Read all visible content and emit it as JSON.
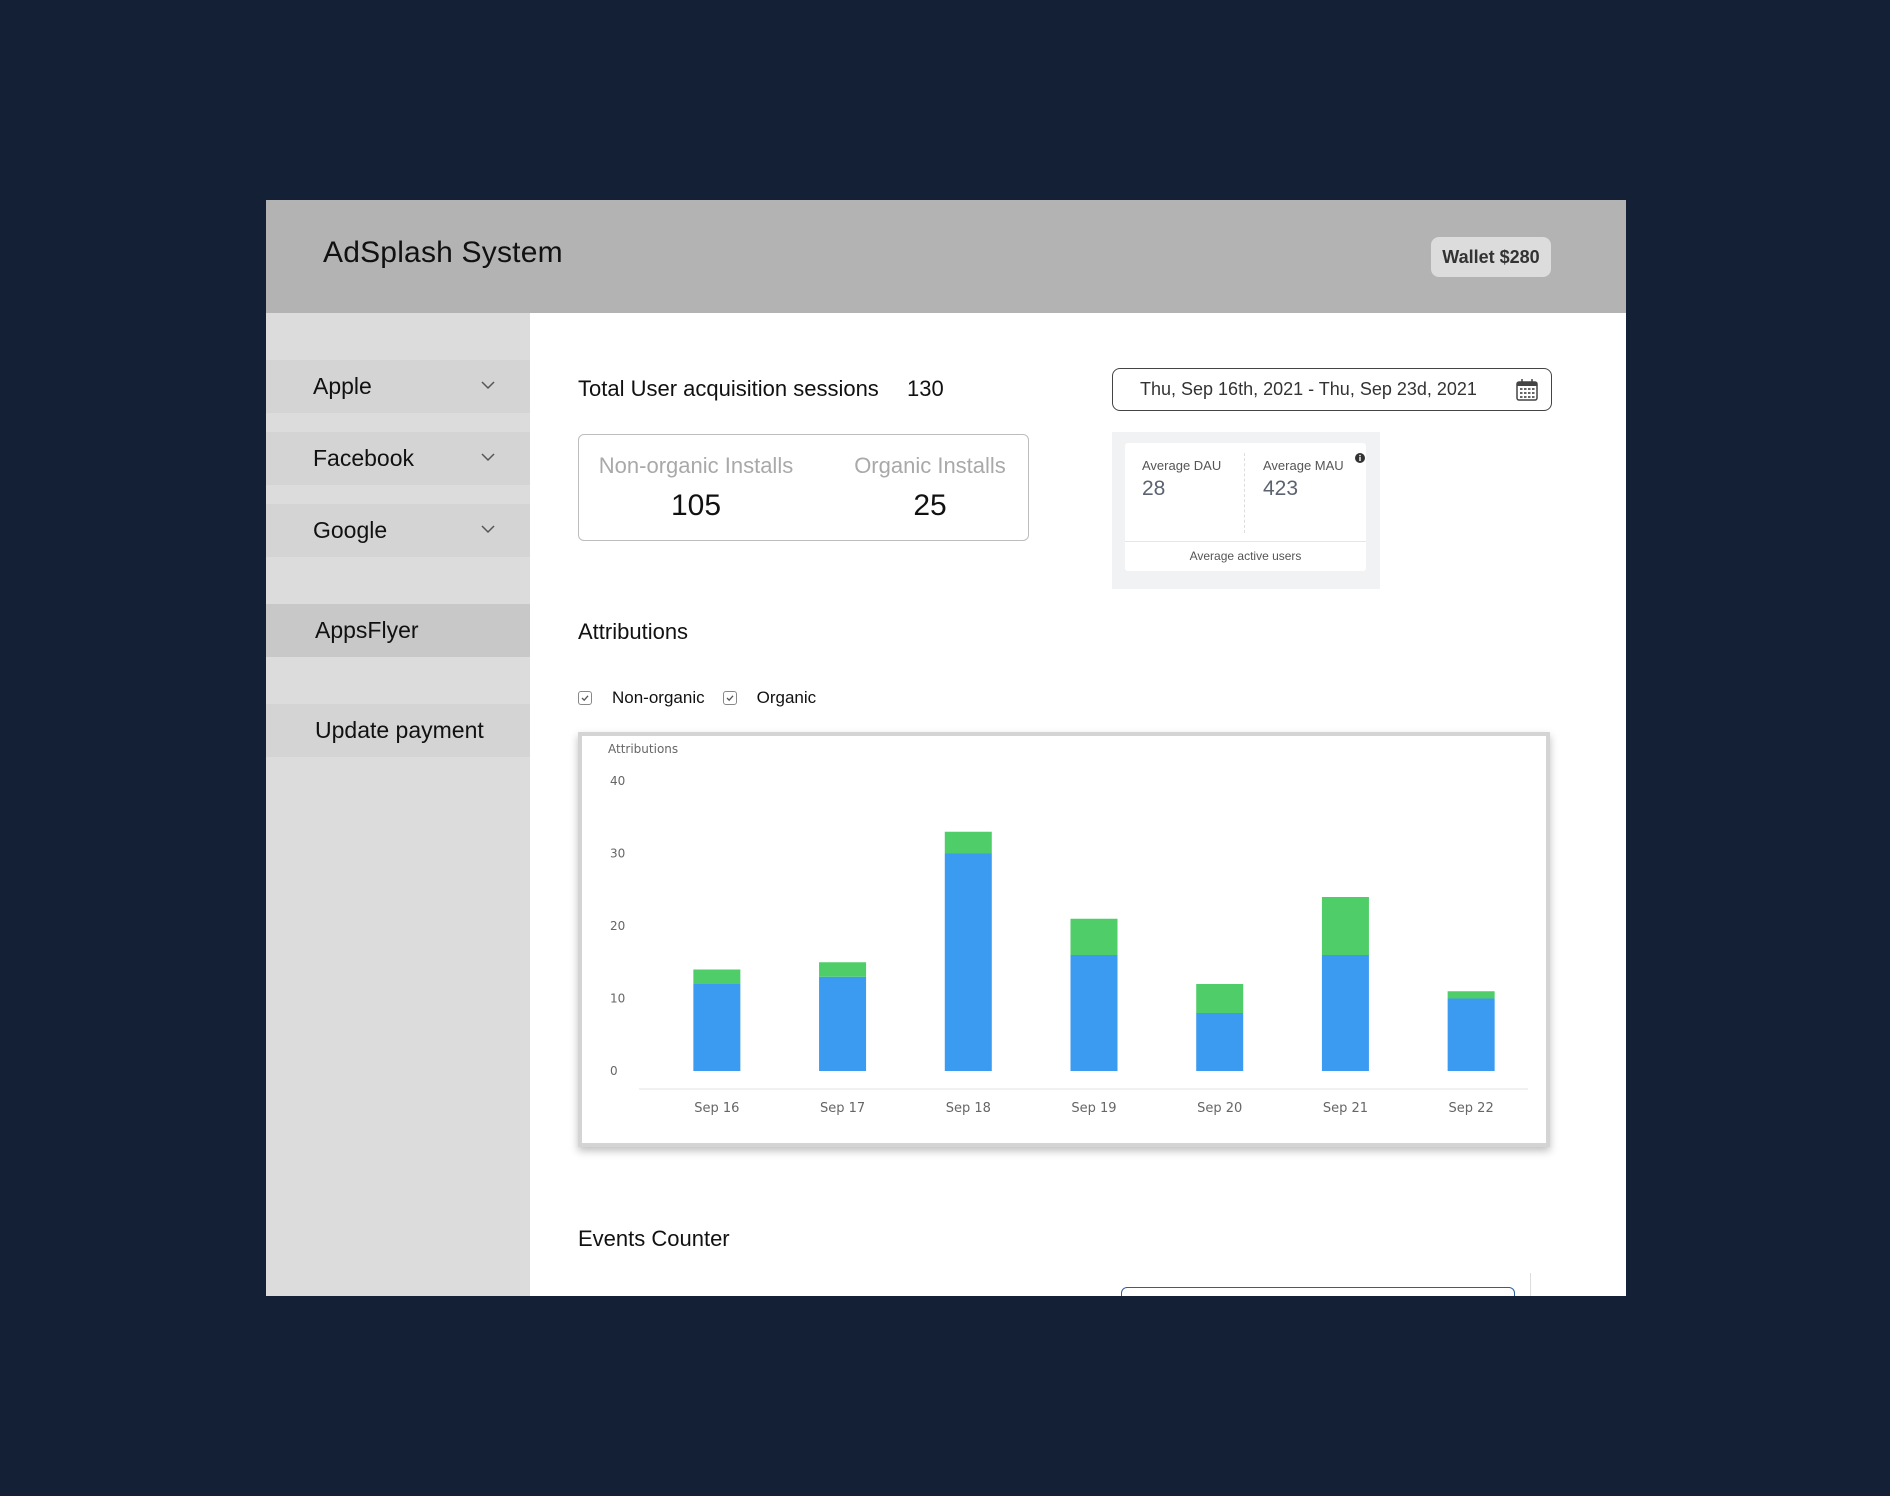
{
  "header": {
    "title": "AdSplash System",
    "wallet": "Wallet $280"
  },
  "sidebar": {
    "items": [
      {
        "label": "Apple",
        "icon": "chevron-down-icon"
      },
      {
        "label": "Facebook",
        "icon": "chevron-down-icon"
      },
      {
        "label": "Google",
        "icon": "chevron-down-icon"
      },
      {
        "label": "AppsFlyer",
        "active": true
      },
      {
        "label": "Update payment"
      }
    ]
  },
  "summary": {
    "sessions_label": "Total User acquisition sessions",
    "sessions_value": "130",
    "non_organic_label": "Non-organic Installs",
    "non_organic_value": "105",
    "organic_label": "Organic Installs",
    "organic_value": "25"
  },
  "date_range": {
    "value": "Thu, Sep 16th, 2021 - Thu, Sep 23d, 2021",
    "icon": "calendar-icon"
  },
  "active_users": {
    "dau_label": "Average DAU",
    "dau_value": "28",
    "mau_label": "Average MAU",
    "mau_value": "423",
    "footer": "Average active users",
    "icon": "info-icon"
  },
  "attributions": {
    "title": "Attributions",
    "legend": [
      {
        "label": "Non-organic",
        "checked": true,
        "color": "#3a9bf0"
      },
      {
        "label": "Organic",
        "checked": true,
        "color": "#4fcd68"
      }
    ]
  },
  "chart_data": {
    "type": "bar",
    "stacked": true,
    "ylabel": "Attributions",
    "categories": [
      "Sep 16",
      "Sep 17",
      "Sep 18",
      "Sep 19",
      "Sep 20",
      "Sep 21",
      "Sep 22"
    ],
    "series": [
      {
        "name": "Non-organic",
        "color": "#3a9bf0",
        "values": [
          12,
          13,
          30,
          16,
          8,
          16,
          10
        ]
      },
      {
        "name": "Organic",
        "color": "#4fcd68",
        "values": [
          2,
          2,
          3,
          5,
          4,
          8,
          1
        ]
      }
    ],
    "ylim": [
      0,
      40
    ],
    "yticks": [
      0,
      10,
      20,
      30,
      40
    ],
    "grid": false
  },
  "events": {
    "title": "Events Counter"
  }
}
